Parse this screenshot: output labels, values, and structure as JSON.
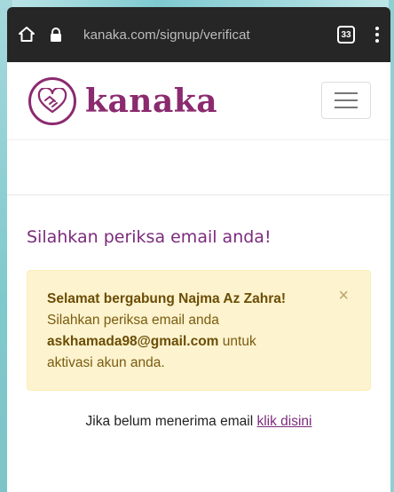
{
  "browser": {
    "url": "kanaka.com/signup/verificat",
    "tab_count": "33",
    "icons": {
      "home": "home-icon",
      "lock": "lock-icon",
      "menu": "vertical-dots-icon"
    }
  },
  "site": {
    "brand": "kanaka",
    "brand_color": "#8b2a6f",
    "logo_icon": "heart-handshake-icon"
  },
  "page": {
    "heading": "Silahkan periksa email anda!",
    "alert": {
      "title": "Selamat bergabung Najma Az Zahra!",
      "line1": "Silahkan periksa email anda",
      "email": "askhamada98@gmail.com",
      "line2_suffix": " untuk",
      "line3": "aktivasi akun anda.",
      "close_label": "×"
    },
    "resend": {
      "text": "Jika belum menerima email ",
      "link": "klik disini"
    }
  }
}
